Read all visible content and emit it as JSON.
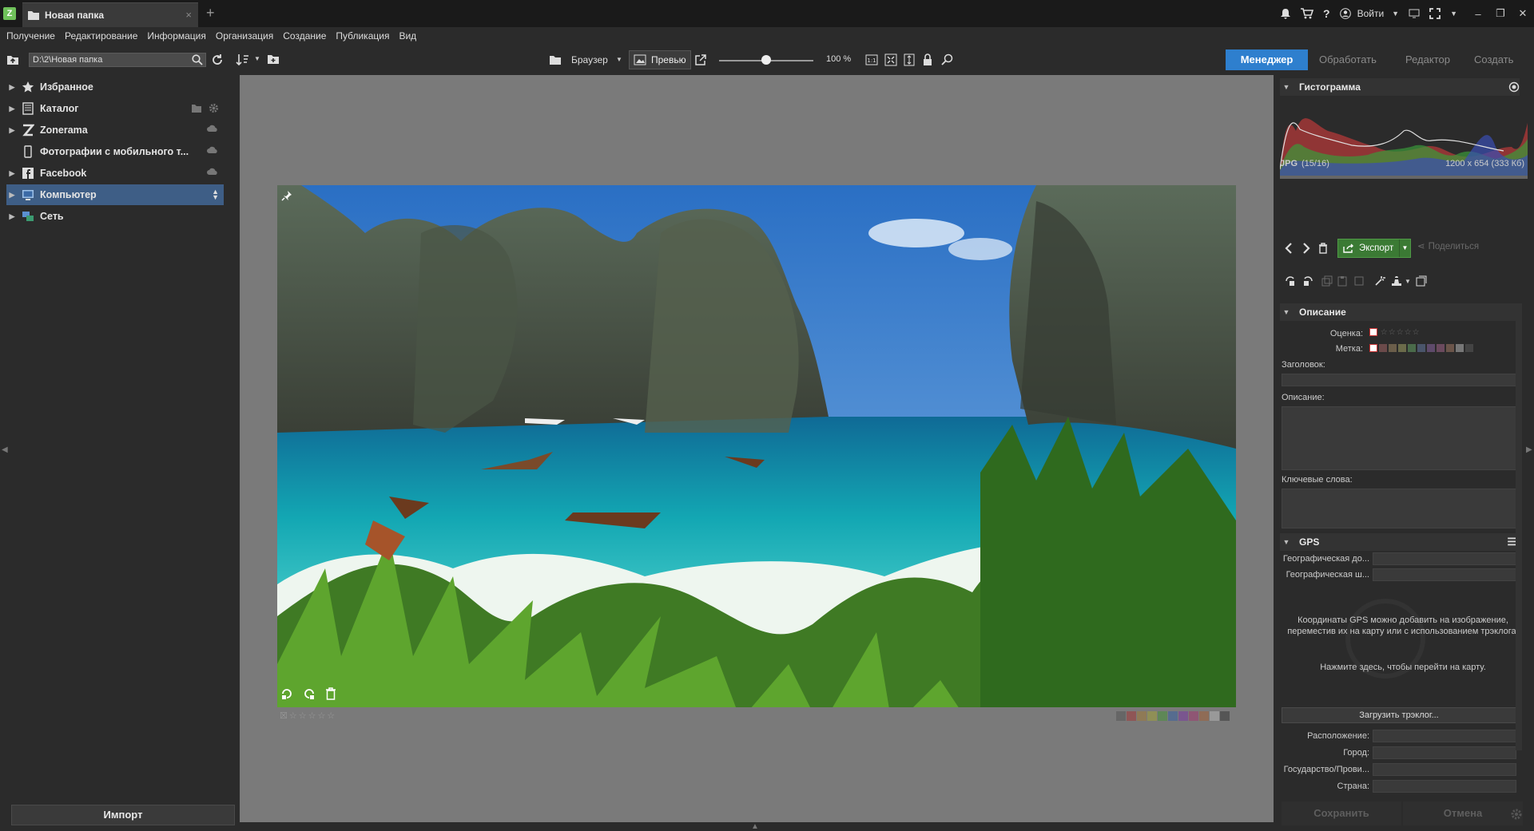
{
  "titlebar": {
    "tab_title": "Новая папка",
    "login_label": "Войти"
  },
  "menu": [
    "Получение",
    "Редактирование",
    "Информация",
    "Организация",
    "Создание",
    "Публикация",
    "Вид"
  ],
  "toolbar": {
    "path": "D:\\2\\Новая папка",
    "browser_label": "Браузер",
    "preview_label": "Превью",
    "zoom_label": "100 %",
    "zoom_level_percent": 100
  },
  "modes": {
    "manager": "Менеджер",
    "process": "Обработать",
    "editor": "Редактор",
    "create": "Создать"
  },
  "nav": [
    {
      "label": "Избранное",
      "icon": "star-icon"
    },
    {
      "label": "Каталог",
      "icon": "catalog-icon"
    },
    {
      "label": "Zonerama",
      "icon": "zonerama-icon"
    },
    {
      "label": "Фотографии с мобильного т...",
      "icon": "mobile-icon"
    },
    {
      "label": "Facebook",
      "icon": "facebook-icon"
    },
    {
      "label": "Компьютер",
      "icon": "computer-icon"
    },
    {
      "label": "Сеть",
      "icon": "network-icon"
    }
  ],
  "import_label": "Импорт",
  "histogram": {
    "title": "Гистограмма",
    "format": "JPG",
    "index": "(15/16)",
    "dimensions": "1200 x 654 (333 Кб)"
  },
  "actions": {
    "export": "Экспорт",
    "share": "Поделиться"
  },
  "description": {
    "title": "Описание",
    "rating_label": "Оценка:",
    "label_label": "Метка:",
    "heading_label": "Заголовок:",
    "description_label": "Описание:",
    "keywords_label": "Ключевые слова:"
  },
  "gps": {
    "title": "GPS",
    "lat_label": "Географическая до...",
    "lon_label": "Географическая ш...",
    "note": "Координаты GPS можно добавить на изображение, переместив их на карту или с использованием трэклога.",
    "map_link": "Нажмите здесь, чтобы перейти на карту.",
    "load_track": "Загрузить трэклог...",
    "location_label": "Расположение:",
    "city_label": "Город:",
    "state_label": "Государство/Прови...",
    "country_label": "Страна:"
  },
  "footer": {
    "save": "Сохранить",
    "cancel": "Отмена"
  },
  "colors": {
    "accent": "#2e7fce",
    "export_green": "#3b7a34",
    "selected_nav": "#3e5e86"
  }
}
